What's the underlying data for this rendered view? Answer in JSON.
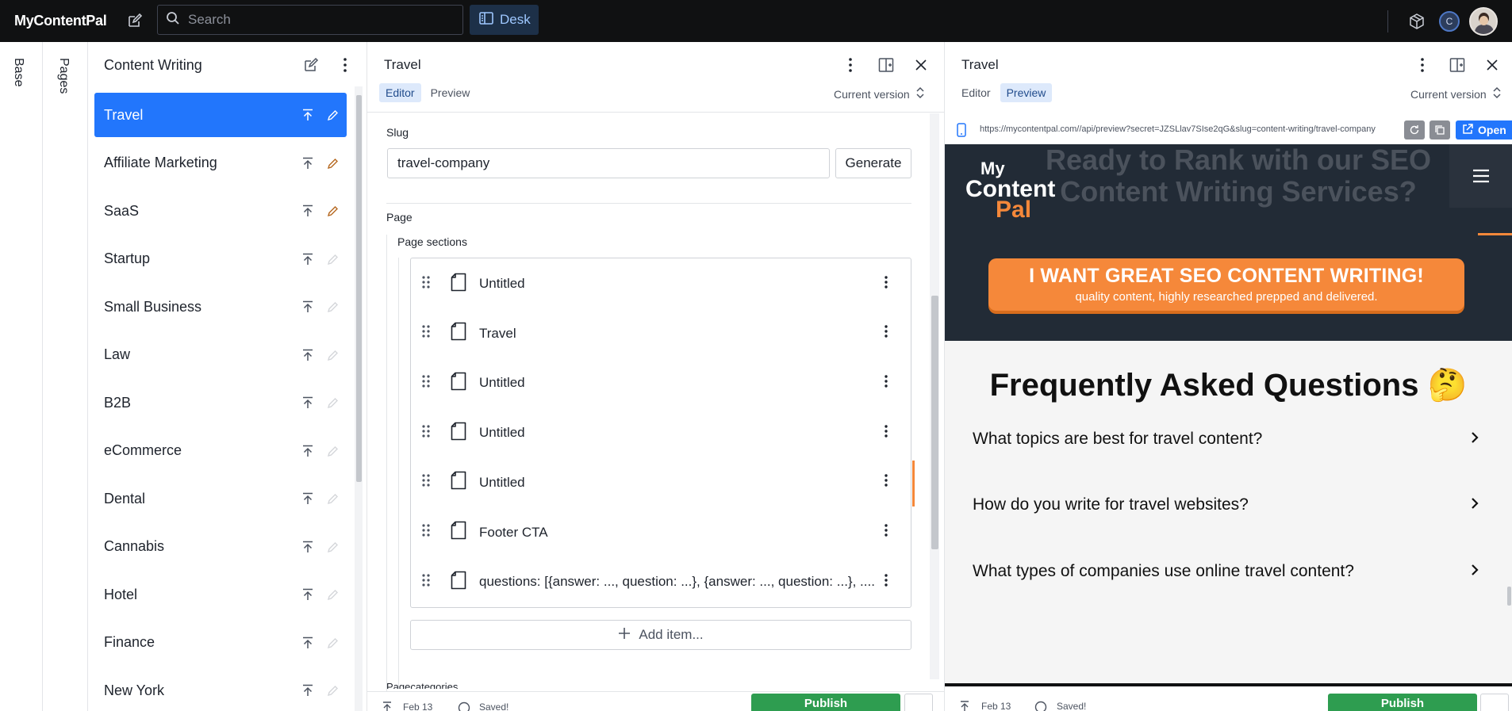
{
  "app": {
    "brand": "MyContentPal",
    "search_placeholder": "Search",
    "desk_label": "Desk",
    "user_initial": "C"
  },
  "rails": {
    "base_label": "Base",
    "pages_label": "Pages"
  },
  "list_pane": {
    "title": "Content Writing",
    "items": [
      {
        "label": "Travel",
        "selected": true,
        "edit_state": "active"
      },
      {
        "label": "Affiliate Marketing",
        "selected": false,
        "edit_state": "draft"
      },
      {
        "label": "SaaS",
        "selected": false,
        "edit_state": "draft"
      },
      {
        "label": "Startup",
        "selected": false,
        "edit_state": "none"
      },
      {
        "label": "Small Business",
        "selected": false,
        "edit_state": "none"
      },
      {
        "label": "Law",
        "selected": false,
        "edit_state": "none"
      },
      {
        "label": "B2B",
        "selected": false,
        "edit_state": "none"
      },
      {
        "label": "eCommerce",
        "selected": false,
        "edit_state": "none"
      },
      {
        "label": "Dental",
        "selected": false,
        "edit_state": "none"
      },
      {
        "label": "Cannabis",
        "selected": false,
        "edit_state": "none"
      },
      {
        "label": "Hotel",
        "selected": false,
        "edit_state": "none"
      },
      {
        "label": "Finance",
        "selected": false,
        "edit_state": "none"
      },
      {
        "label": "New York",
        "selected": false,
        "edit_state": "none"
      }
    ]
  },
  "editor": {
    "title": "Travel",
    "tabs": [
      "Editor",
      "Preview"
    ],
    "active_tab": "Editor",
    "version_label": "Current version",
    "slug_label": "Slug",
    "slug_value": "travel-company",
    "generate_label": "Generate",
    "page_label": "Page",
    "page_sections_label": "Page sections",
    "sections": [
      "Untitled",
      "Travel",
      "Untitled",
      "Untitled",
      "Untitled",
      "Footer CTA",
      "questions: [{answer: ..., question: ...}, {answer: ..., question: ...}, ......"
    ],
    "add_item_label": "Add item...",
    "next_field_label": "Pagecategories",
    "footer_date": "Feb 13",
    "footer_status": "Saved!",
    "publish_label": "Publish"
  },
  "preview": {
    "title": "Travel",
    "tabs": [
      "Editor",
      "Preview"
    ],
    "active_tab": "Preview",
    "version_label": "Current version",
    "url": "https://mycontentpal.com//api/preview?secret=JZSLlav7SIse2qG&slug=content-writing/travel-company",
    "open_label": "Open",
    "site": {
      "ghost_heading": "Ready to Rank with our SEO Content Writing Services?",
      "logo_my": "My",
      "logo_content": "Content",
      "logo_pal": "Pal",
      "cta_main": "I WANT GREAT SEO CONTENT WRITING!",
      "cta_sub": "quality content, highly researched prepped and delivered.",
      "faq_title": "Frequently Asked Questions 🤔",
      "faq": [
        "What topics are best for travel content?",
        "How do you write for travel websites?",
        "What types of companies use online travel content?"
      ]
    },
    "footer_date": "Feb 13",
    "footer_status": "Saved!",
    "publish_label": "Publish"
  },
  "colors": {
    "topbar_bg": "#101112",
    "accent_blue": "#2276fc",
    "brand_orange": "#f5883a",
    "site_dark": "#222b36",
    "publish_green": "#2e9d50"
  }
}
